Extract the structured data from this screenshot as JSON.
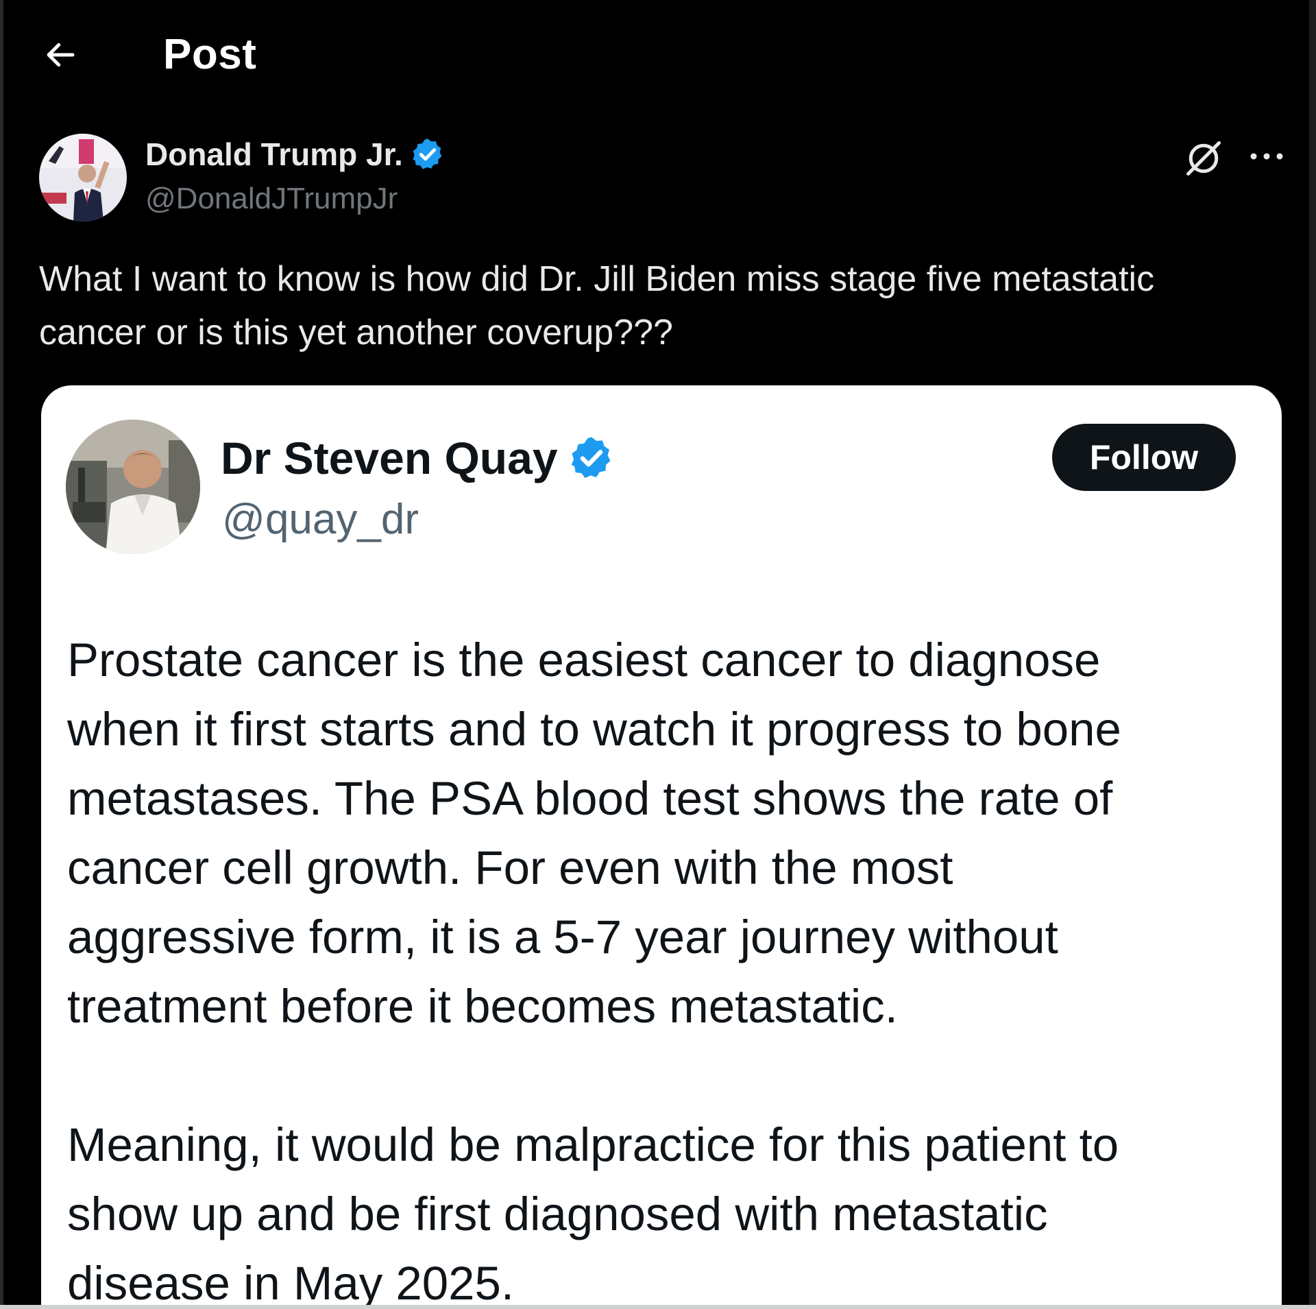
{
  "header": {
    "title": "Post",
    "back_icon": "arrow-left-icon"
  },
  "post": {
    "author_name": "Donald Trump Jr.",
    "author_handle": "@DonaldJTrumpJr",
    "verified_icon": "verified-badge-icon",
    "verified_color": "#1d9bf0",
    "grok_icon": "grok-icon",
    "more_icon": "more-horizontal-icon",
    "text": "What I want to know is how did Dr. Jill Biden miss stage five metastatic\ncancer or is this yet another coverup???"
  },
  "embedded": {
    "author_name": "Dr Steven Quay",
    "author_handle": "@quay_dr",
    "follow_label": "Follow",
    "paragraph_1": "Prostate cancer is the easiest cancer to diagnose\nwhen it first starts and to watch it progress to bone\nmetastases. The PSA blood test shows the rate of\ncancer cell growth. For even with the most\naggressive form, it is a 5-7 year journey without\ntreatment before it becomes metastatic.",
    "paragraph_2": "Meaning, it would be malpractice for this patient to\nshow up and be first diagnosed with metastatic\ndisease in May 2025."
  },
  "colors": {
    "background": "#000000",
    "text_primary": "#e7e9ea",
    "text_secondary": "#71767b",
    "card_background": "#ffffff",
    "card_text": "#0f1419",
    "card_secondary": "#536471",
    "accent": "#1d9bf0"
  }
}
